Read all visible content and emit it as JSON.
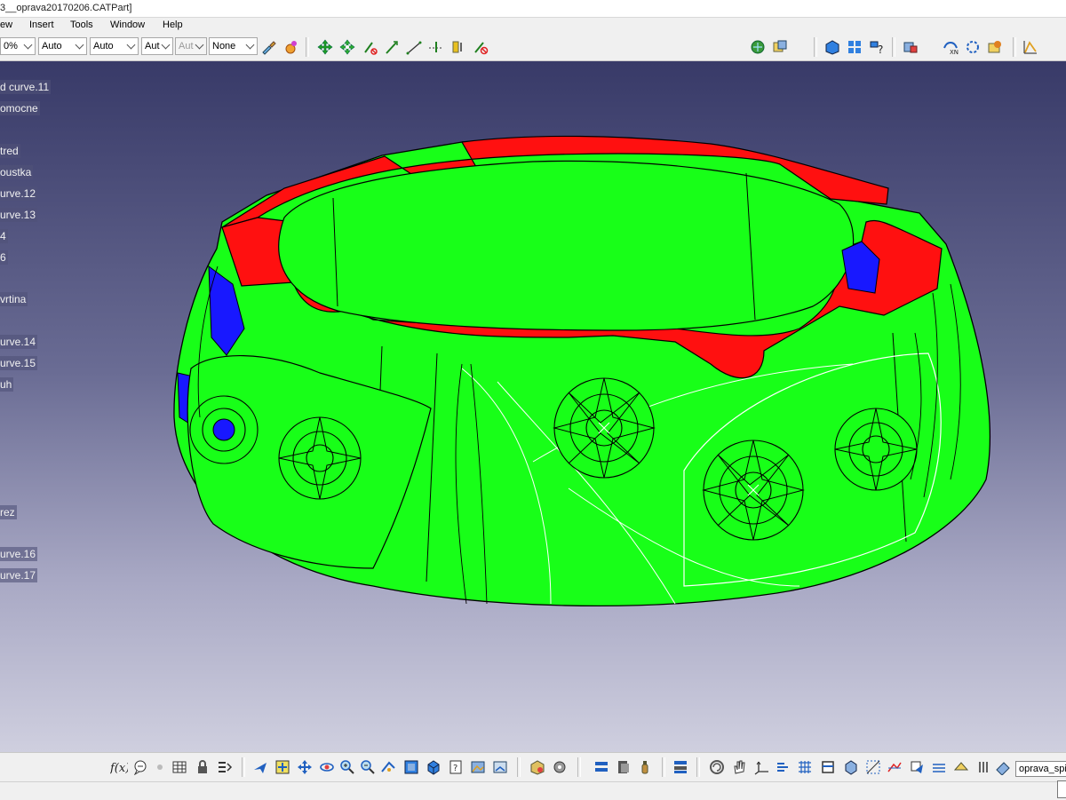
{
  "window": {
    "title": "3__oprava20170206.CATPart]"
  },
  "menu": [
    "ew",
    "Insert",
    "Tools",
    "Window",
    "Help"
  ],
  "toolbar": {
    "zoom_value": "0%",
    "combos": [
      "Auto",
      "Auto",
      "Aut",
      "Aut",
      "None"
    ]
  },
  "tree": [
    "d curve.11",
    "omocne",
    "tred",
    "oustka",
    "urve.12",
    "urve.13",
    "4",
    "6",
    "vrtina",
    "urve.14",
    "urve.15",
    "uh",
    "rez",
    "urve.16",
    "urve.17"
  ],
  "command_input": {
    "value": "oprava_spic"
  },
  "colors": {
    "background_top": "#383a68",
    "background_bottom": "#cfcfdf",
    "surface_green": "#18ff18",
    "surface_red": "#ff1010",
    "surface_blue": "#1818ff"
  },
  "icons": {
    "top": [
      "paint-brush-icon",
      "apply-material-icon",
      "translate-icon",
      "rotate-icon",
      "snap-icon",
      "analysis-icon",
      "axis-icon",
      "spline-icon",
      "measure-icon",
      "catalog-icon",
      "sketch-tools-icon",
      "copy-icon",
      "compass-icon",
      "view-icon",
      "settings-icon",
      "drafting-icon"
    ],
    "bottom": [
      "formula-icon",
      "knowledge-icon",
      "measure-item-icon",
      "table-icon",
      "lock-icon",
      "parameters-icon",
      "fly-icon",
      "fit-all-icon",
      "pan-icon",
      "rotate-view-icon",
      "zoom-in-icon",
      "zoom-out-icon",
      "normal-view-icon",
      "iso-view-icon",
      "hide-show-icon",
      "swap-visible-icon",
      "render-icon",
      "lights-icon",
      "save-icon",
      "print-icon",
      "open-icon",
      "file-icon",
      "undo-icon",
      "hand-icon",
      "axis-system-icon",
      "plane-icon",
      "grid-icon",
      "box-icon",
      "cube-icon",
      "extract-icon",
      "boundary-icon",
      "point-icon",
      "line-icon",
      "curve-icon",
      "projection-icon",
      "eraser-icon"
    ]
  }
}
